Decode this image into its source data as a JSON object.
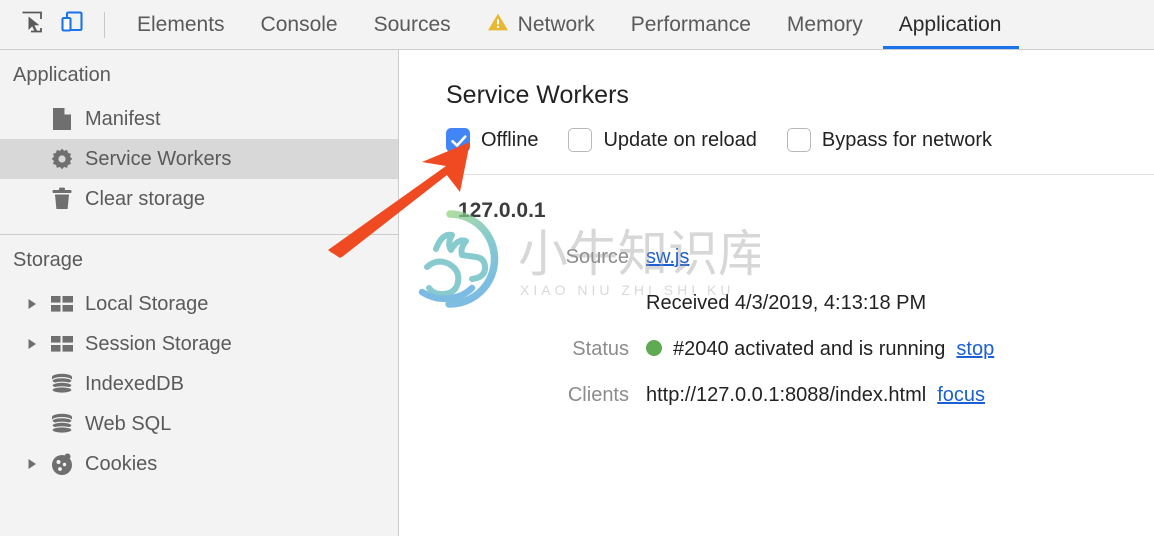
{
  "toolbar": {
    "inspect_icon": "inspect-cursor-icon",
    "device_icon": "device-toolbar-icon",
    "tabs": [
      {
        "label": "Elements",
        "active": false,
        "icon": null
      },
      {
        "label": "Console",
        "active": false,
        "icon": null
      },
      {
        "label": "Sources",
        "active": false,
        "icon": null
      },
      {
        "label": "Network",
        "active": false,
        "icon": "warning-triangle-icon"
      },
      {
        "label": "Performance",
        "active": false,
        "icon": null
      },
      {
        "label": "Memory",
        "active": false,
        "icon": null
      },
      {
        "label": "Application",
        "active": true,
        "icon": null
      }
    ]
  },
  "sidebar": {
    "application": {
      "title": "Application",
      "items": [
        {
          "label": "Manifest",
          "icon": "document-icon",
          "selected": false,
          "expandable": false
        },
        {
          "label": "Service Workers",
          "icon": "gear-icon",
          "selected": true,
          "expandable": false
        },
        {
          "label": "Clear storage",
          "icon": "trash-icon",
          "selected": false,
          "expandable": false
        }
      ]
    },
    "storage": {
      "title": "Storage",
      "items": [
        {
          "label": "Local Storage",
          "icon": "table-grid-icon",
          "selected": false,
          "expandable": true
        },
        {
          "label": "Session Storage",
          "icon": "table-grid-icon",
          "selected": false,
          "expandable": true
        },
        {
          "label": "IndexedDB",
          "icon": "database-icon",
          "selected": false,
          "expandable": false
        },
        {
          "label": "Web SQL",
          "icon": "database-icon",
          "selected": false,
          "expandable": false
        },
        {
          "label": "Cookies",
          "icon": "cookie-icon",
          "selected": false,
          "expandable": true
        }
      ]
    }
  },
  "main": {
    "title": "Service Workers",
    "options": [
      {
        "label": "Offline",
        "checked": true
      },
      {
        "label": "Update on reload",
        "checked": false
      },
      {
        "label": "Bypass for network",
        "checked": false
      }
    ],
    "record": {
      "origin": "127.0.0.1",
      "source_key": "Source",
      "source_value": "sw.js",
      "received_text": "Received 4/3/2019, 4:13:18 PM",
      "status_key": "Status",
      "status_value": "#2040 activated and is running",
      "status_action": "stop",
      "clients_key": "Clients",
      "clients_value": "http://127.0.0.1:8088/index.html",
      "clients_action": "focus"
    }
  },
  "watermark": {
    "text_cn": "小牛知识库",
    "text_pinyin": "XIAO NIU ZHI SHI KU"
  },
  "colors": {
    "accent_blue": "#1a73e8",
    "checkbox_blue": "#4285f4",
    "link_blue": "#1a5fd4",
    "status_green": "#5faa53",
    "warning_yellow": "#e8b733",
    "arrow_orange": "#ef4a22",
    "chrome_gray": "#f3f3f3",
    "selected_gray": "#d8d8d8"
  }
}
